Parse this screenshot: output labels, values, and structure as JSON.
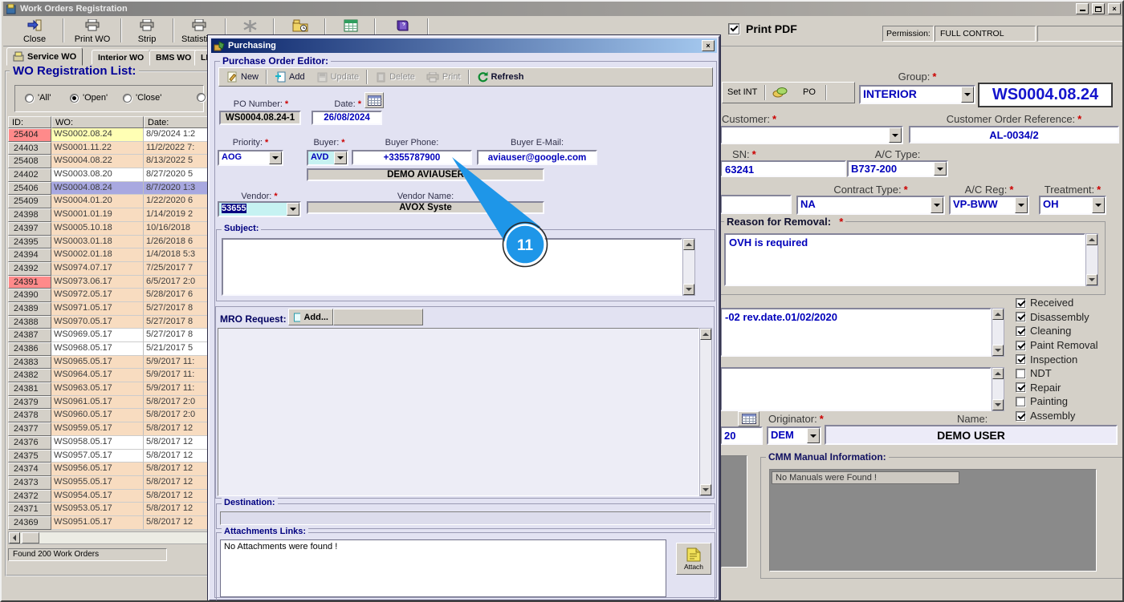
{
  "window": {
    "title": "Work Orders Registration",
    "print_pdf_label": "Print PDF",
    "print_pdf_checked": true,
    "permission_label": "Permission:",
    "permission_value": "FULL CONTROL"
  },
  "required_marker": "*",
  "toolbar": {
    "buttons": [
      {
        "label": "Close",
        "icon": "close-icon"
      },
      {
        "label": "Print WO",
        "icon": "printer-icon"
      },
      {
        "label": "Strip",
        "icon": "printer-icon"
      },
      {
        "label": "Statistics",
        "icon": "printer-icon"
      }
    ],
    "icon_buttons": [
      "snowflake-icon",
      "folder-clock-icon",
      "excel-icon",
      "book-icon"
    ]
  },
  "tabs": [
    {
      "label": "Service WO",
      "active": true
    },
    {
      "label": "Interior WO",
      "active": false
    },
    {
      "label": "BMS WO",
      "active": false
    },
    {
      "label": "LMS WO",
      "active": false
    }
  ],
  "wo_list": {
    "title": "WO Registration List:",
    "filters": [
      {
        "label": "'All'",
        "selected": false
      },
      {
        "label": "'Open'",
        "selected": true
      },
      {
        "label": "'Close'",
        "selected": false
      },
      {
        "label": "",
        "selected": false
      }
    ],
    "columns": [
      "ID:",
      "WO:",
      "Date:"
    ],
    "status": "Found 200 Work Orders",
    "rows": [
      {
        "id": "25404",
        "wo": "WS0002.08.24",
        "date": "8/9/2024 1:2",
        "id_style": "alert",
        "wo_style": "yellow",
        "date_style": "white"
      },
      {
        "id": "24403",
        "wo": "WS0001.11.22",
        "date": "11/2/2022 7:",
        "id_style": "normal",
        "wo_style": "peach",
        "date_style": "peach"
      },
      {
        "id": "25408",
        "wo": "WS0004.08.22",
        "date": "8/13/2022 5",
        "id_style": "normal",
        "wo_style": "peach",
        "date_style": "peach"
      },
      {
        "id": "24402",
        "wo": "WS0003.08.20",
        "date": "8/27/2020 5",
        "id_style": "normal",
        "wo_style": "white",
        "date_style": "white"
      },
      {
        "id": "25406",
        "wo": "WS0004.08.24",
        "date": "8/7/2020 1:3",
        "id_style": "normal",
        "wo_style": "selected",
        "date_style": "selected"
      },
      {
        "id": "25409",
        "wo": "WS0004.01.20",
        "date": "1/22/2020 6",
        "id_style": "normal",
        "wo_style": "peach",
        "date_style": "peach"
      },
      {
        "id": "24398",
        "wo": "WS0001.01.19",
        "date": "1/14/2019 2",
        "id_style": "normal",
        "wo_style": "peach",
        "date_style": "peach"
      },
      {
        "id": "24397",
        "wo": "WS0005.10.18",
        "date": "10/16/2018",
        "id_style": "normal",
        "wo_style": "peach",
        "date_style": "peach"
      },
      {
        "id": "24395",
        "wo": "WS0003.01.18",
        "date": "1/26/2018 6",
        "id_style": "normal",
        "wo_style": "peach",
        "date_style": "peach"
      },
      {
        "id": "24394",
        "wo": "WS0002.01.18",
        "date": "1/4/2018 5:3",
        "id_style": "normal",
        "wo_style": "peach",
        "date_style": "peach"
      },
      {
        "id": "24392",
        "wo": "WS0974.07.17",
        "date": "7/25/2017 7",
        "id_style": "normal",
        "wo_style": "peach",
        "date_style": "peach"
      },
      {
        "id": "24391",
        "wo": "WS0973.06.17",
        "date": "6/5/2017 2:0",
        "id_style": "alert",
        "wo_style": "peach",
        "date_style": "peach"
      },
      {
        "id": "24390",
        "wo": "WS0972.05.17",
        "date": "5/28/2017 6",
        "id_style": "normal",
        "wo_style": "peach",
        "date_style": "peach"
      },
      {
        "id": "24389",
        "wo": "WS0971.05.17",
        "date": "5/27/2017 8",
        "id_style": "normal",
        "wo_style": "peach",
        "date_style": "peach"
      },
      {
        "id": "24388",
        "wo": "WS0970.05.17",
        "date": "5/27/2017 8",
        "id_style": "normal",
        "wo_style": "peach",
        "date_style": "peach"
      },
      {
        "id": "24387",
        "wo": "WS0969.05.17",
        "date": "5/27/2017 8",
        "id_style": "normal",
        "wo_style": "white",
        "date_style": "white"
      },
      {
        "id": "24386",
        "wo": "WS0968.05.17",
        "date": "5/21/2017 5",
        "id_style": "normal",
        "wo_style": "white",
        "date_style": "white"
      },
      {
        "id": "24383",
        "wo": "WS0965.05.17",
        "date": "5/9/2017 11:",
        "id_style": "normal",
        "wo_style": "peach",
        "date_style": "peach"
      },
      {
        "id": "24382",
        "wo": "WS0964.05.17",
        "date": "5/9/2017 11:",
        "id_style": "normal",
        "wo_style": "peach",
        "date_style": "peach"
      },
      {
        "id": "24381",
        "wo": "WS0963.05.17",
        "date": "5/9/2017 11:",
        "id_style": "normal",
        "wo_style": "peach",
        "date_style": "peach"
      },
      {
        "id": "24379",
        "wo": "WS0961.05.17",
        "date": "5/8/2017 2:0",
        "id_style": "normal",
        "wo_style": "peach",
        "date_style": "peach"
      },
      {
        "id": "24378",
        "wo": "WS0960.05.17",
        "date": "5/8/2017 2:0",
        "id_style": "normal",
        "wo_style": "peach",
        "date_style": "peach"
      },
      {
        "id": "24377",
        "wo": "WS0959.05.17",
        "date": "5/8/2017 12",
        "id_style": "normal",
        "wo_style": "peach",
        "date_style": "peach"
      },
      {
        "id": "24376",
        "wo": "WS0958.05.17",
        "date": "5/8/2017 12",
        "id_style": "normal",
        "wo_style": "white",
        "date_style": "white"
      },
      {
        "id": "24375",
        "wo": "WS0957.05.17",
        "date": "5/8/2017 12",
        "id_style": "normal",
        "wo_style": "white",
        "date_style": "white"
      },
      {
        "id": "24374",
        "wo": "WS0956.05.17",
        "date": "5/8/2017 12",
        "id_style": "normal",
        "wo_style": "peach",
        "date_style": "peach"
      },
      {
        "id": "24373",
        "wo": "WS0955.05.17",
        "date": "5/8/2017 12",
        "id_style": "normal",
        "wo_style": "peach",
        "date_style": "peach"
      },
      {
        "id": "24372",
        "wo": "WS0954.05.17",
        "date": "5/8/2017 12",
        "id_style": "normal",
        "wo_style": "peach",
        "date_style": "peach"
      },
      {
        "id": "24371",
        "wo": "WS0953.05.17",
        "date": "5/8/2017 12",
        "id_style": "normal",
        "wo_style": "peach",
        "date_style": "peach"
      },
      {
        "id": "24369",
        "wo": "WS0951.05.17",
        "date": "5/8/2017 12",
        "id_style": "normal",
        "wo_style": "peach",
        "date_style": "peach"
      }
    ]
  },
  "purchasing": {
    "title": "Purchasing",
    "group_title": "Purchase Order Editor:",
    "toolbar": [
      {
        "name": "new",
        "label": "New",
        "enabled": true
      },
      {
        "name": "add",
        "label": "Add",
        "enabled": true
      },
      {
        "name": "update",
        "label": "Update",
        "enabled": false
      },
      {
        "name": "delete",
        "label": "Delete",
        "enabled": false
      },
      {
        "name": "print",
        "label": "Print",
        "enabled": false
      },
      {
        "name": "refresh",
        "label": "Refresh",
        "enabled": true
      }
    ],
    "fields": {
      "po_number": {
        "label": "PO Number:",
        "value": "WS0004.08.24-1"
      },
      "date": {
        "label": "Date:",
        "value": "26/08/2024"
      },
      "priority": {
        "label": "Priority:",
        "value": "AOG"
      },
      "buyer": {
        "label": "Buyer:",
        "value": "AVD"
      },
      "buyer_name": {
        "value": "DEMO AVIAUSER"
      },
      "buyer_phone": {
        "label": "Buyer Phone:",
        "value": "+3355787900"
      },
      "buyer_email": {
        "label": "Buyer E-Mail:",
        "value": "aviauser@google.com"
      },
      "vendor": {
        "label": "Vendor:",
        "value": "53655"
      },
      "vendor_name": {
        "label": "Vendor Name:",
        "value": "AVOX Syste"
      },
      "subject": {
        "label": "Subject:",
        "value": ""
      },
      "mro_request": {
        "label": "MRO Request:",
        "add_label": "Add...",
        "value": ""
      },
      "destination": {
        "label": "Destination:",
        "value": ""
      },
      "attachments": {
        "label": "Attachments Links:",
        "value": "No Attachments were found !",
        "attach_label": "Attach"
      }
    }
  },
  "main_form": {
    "set_int_label": "Set INT",
    "po_button_label": "PO",
    "group": {
      "label": "Group:",
      "value": "INTERIOR"
    },
    "wo_number": "WS0004.08.24",
    "customer": {
      "label": "Customer:",
      "value": ""
    },
    "customer_order_ref": {
      "label": "Customer Order Reference:",
      "value": "AL-0034/2"
    },
    "sn": {
      "label": "SN:",
      "value": "63241"
    },
    "ac_type": {
      "label": "A/C Type:",
      "value": "B737-200"
    },
    "contract_type": {
      "label": "Contract Type:",
      "value": "NA"
    },
    "ac_reg": {
      "label": "A/C Reg:",
      "value": "VP-BWW"
    },
    "treatment": {
      "label": "Treatment:",
      "value": "OH"
    },
    "reason": {
      "label": "Reason for Removal:",
      "value": "OVH is required"
    },
    "notes": "-02 rev.date.01/02/2020",
    "orig_date_partial": "20",
    "originator": {
      "label": "Originator:",
      "value": "DEM"
    },
    "name": {
      "label": "Name:",
      "value": "DEMO USER"
    },
    "cmm": {
      "label": "CMM Manual Information:",
      "value": "No Manuals were Found !"
    },
    "checkboxes": [
      {
        "label": "Received",
        "checked": true
      },
      {
        "label": "Disassembly",
        "checked": true
      },
      {
        "label": "Cleaning",
        "checked": true
      },
      {
        "label": "Paint Removal",
        "checked": true
      },
      {
        "label": "Inspection",
        "checked": true
      },
      {
        "label": "NDT",
        "checked": false
      },
      {
        "label": "Repair",
        "checked": true
      },
      {
        "label": "Painting",
        "checked": false
      },
      {
        "label": "Assembly",
        "checked": true
      }
    ]
  },
  "callout": {
    "number": "11"
  },
  "colors": {
    "row_default": "#f8dcc0",
    "row_white": "#ffffff",
    "row_yellow": "#ffffb4",
    "row_selected": "#a8a8e0",
    "id_alert": "#ff8a8a",
    "value_text": "#0000bb",
    "dialog_bg": "#e2e2f2",
    "titlebar_start": "#0a246a",
    "titlebar_end": "#a6caf0",
    "callout_blue": "#1e96e8"
  }
}
